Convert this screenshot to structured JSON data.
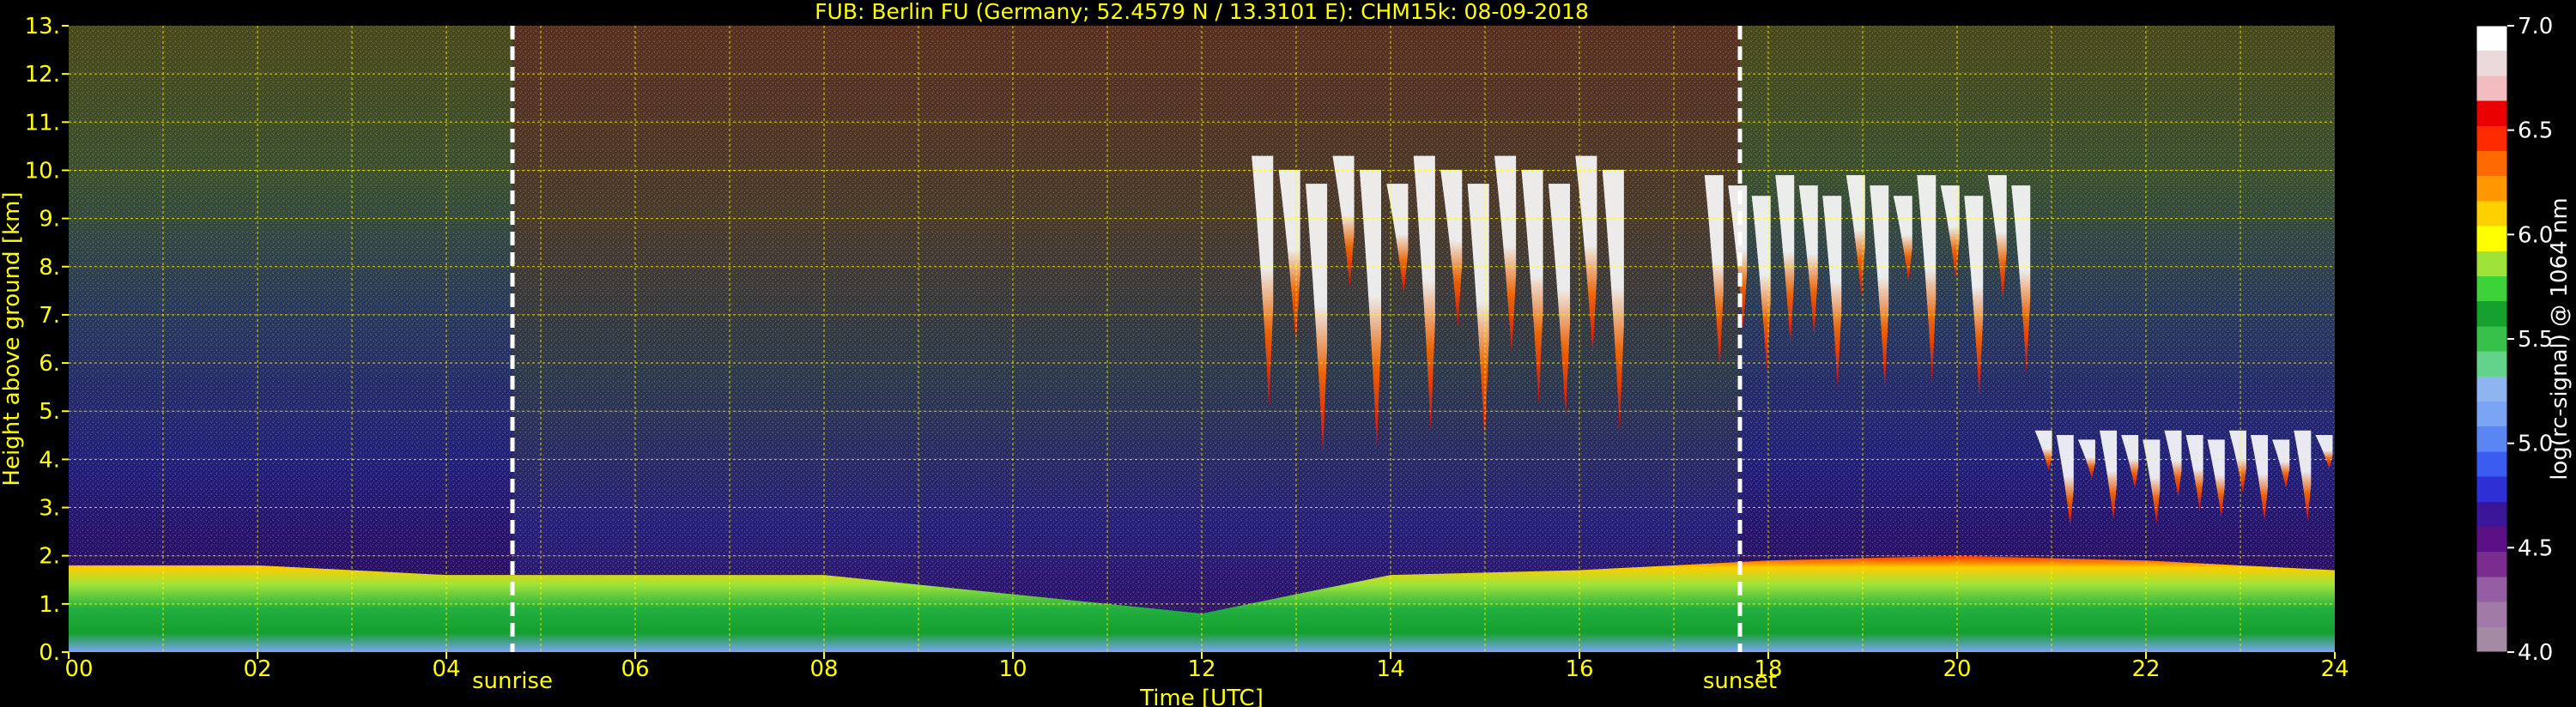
{
  "chart_data": [
    {
      "type": "heatmap",
      "title": "FUB: Berlin FU (Germany; 52.4579 N / 13.3101 E):    CHM15k: 08-09-2018",
      "xlabel": "Time [UTC]",
      "ylabel": "Height above ground [km]",
      "xlim": [
        0,
        24
      ],
      "ylim": [
        0,
        13
      ],
      "x_ticks": [
        "00",
        "02",
        "04",
        "06",
        "08",
        "10",
        "12",
        "14",
        "16",
        "18",
        "20",
        "22",
        "24"
      ],
      "y_ticks": [
        "0.",
        "1.",
        "2.",
        "3.",
        "4.",
        "5.",
        "6.",
        "7.",
        "8.",
        "9.",
        "10.",
        "11.",
        "12.",
        "13."
      ],
      "grid": true,
      "grid_color": "#ffff00",
      "background_color": "#000000",
      "text_color": "#ffff00",
      "markers": [
        {
          "label": "sunrise",
          "time": 4.7
        },
        {
          "label": "sunset",
          "time": 17.7
        }
      ],
      "features": [
        {
          "kind": "boundary-layer",
          "start": 0,
          "end": 24,
          "top_km": [
            1.8,
            1.8,
            1.6,
            1.6,
            1.6,
            1.2,
            0.8,
            1.6,
            1.7,
            1.9,
            2.0,
            1.9,
            1.7
          ]
        },
        {
          "kind": "cirrus",
          "start": 12.5,
          "end": 16.5,
          "base_km": 4.5,
          "top_km": 10.3
        },
        {
          "kind": "cirrus",
          "start": 17.3,
          "end": 20.8,
          "base_km": 5.6,
          "top_km": 9.9
        },
        {
          "kind": "cloud-layer",
          "start": 20.8,
          "end": 24,
          "base_km": 2.7,
          "top_km": 4.6
        }
      ]
    },
    {
      "type": "colorbar",
      "label": "log(rc-signal) @ 1064 nm",
      "range": [
        4.0,
        7.0
      ],
      "ticks": [
        "4.0",
        "4.5",
        "5.0",
        "5.5",
        "6.0",
        "6.5",
        "7.0"
      ],
      "stops": [
        "#a48aa3",
        "#a27aa7",
        "#965ea2",
        "#7a2c8e",
        "#5a0f85",
        "#3a1699",
        "#2f2fd6",
        "#3a5cf0",
        "#5a86f3",
        "#7ca4f5",
        "#8fb5f0",
        "#63d28a",
        "#38c14a",
        "#159f2f",
        "#3ed23a",
        "#9fe33a",
        "#ffff00",
        "#ffd000",
        "#ff9800",
        "#ff6a00",
        "#ff2a00",
        "#ea0000",
        "#f3bcc0",
        "#ebd9dc",
        "#ffffff"
      ]
    }
  ]
}
